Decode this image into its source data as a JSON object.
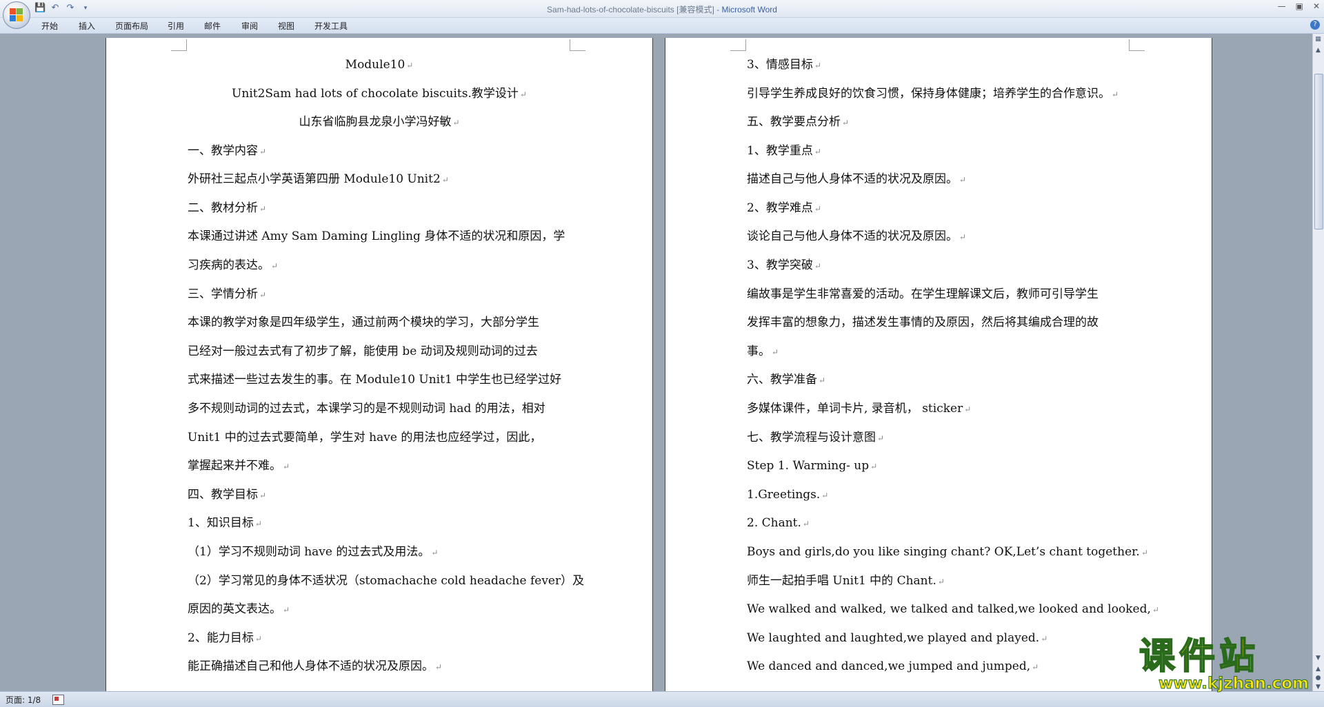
{
  "window": {
    "title_doc": "Sam-had-lots-of-chocolate-biscuits [兼容模式] - ",
    "title_app": "Microsoft Word"
  },
  "ribbon": {
    "tabs": [
      "开始",
      "插入",
      "页面布局",
      "引用",
      "邮件",
      "审阅",
      "视图",
      "开发工具"
    ]
  },
  "page1": {
    "lines": [
      "Module10",
      "Unit2Sam had lots of chocolate biscuits.教学设计",
      "山东省临朐县龙泉小学冯好敏",
      "一、教学内容",
      "外研社三起点小学英语第四册 Module10 Unit2",
      "二、教材分析",
      "本课通过讲述 Amy Sam Daming Lingling 身体不适的状况和原因，学",
      "习疾病的表达。",
      "三、学情分析",
      "本课的教学对象是四年级学生，通过前两个模块的学习，大部分学生",
      "已经对一般过去式有了初步了解，能使用 be 动词及规则动词的过去",
      "式来描述一些过去发生的事。在 Module10 Unit1 中学生也已经学过好",
      "多不规则动词的过去式，本课学习的是不规则动词 had 的用法，相对",
      "Unit1  中的过去式要简单，学生对  have  的用法也应经学过，因此，",
      "掌握起来并不难。",
      "四、教学目标",
      "1、知识目标",
      "（1）学习不规则动词 have 的过去式及用法。",
      "（2）学习常见的身体不适状况（stomachache cold headache fever）及",
      "原因的英文表达。",
      "2、能力目标",
      "能正确描述自己和他人身体不适的状况及原因。"
    ]
  },
  "page2": {
    "lines": [
      "3、情感目标",
      "引导学生养成良好的饮食习惯，保持身体健康；培养学生的合作意识。",
      "五、教学要点分析",
      "1、教学重点",
      "描述自己与他人身体不适的状况及原因。",
      "2、教学难点",
      "谈论自己与他人身体不适的状况及原因。",
      "3、教学突破",
      "编故事是学生非常喜爱的活动。在学生理解课文后，教师可引导学生",
      "发挥丰富的想象力，描述发生事情的及原因，然后将其编成合理的故",
      "事。",
      "六、教学准备",
      "多媒体课件，单词卡片, 录音机，  sticker",
      "七、教学流程与设计意图",
      "Step 1. Warming- up",
      "1.Greetings.",
      "2. Chant.",
      "Boys and girls,do you like singing chant? OK,Let’s chant together.",
      "师生一起拍手唱 Unit1 中的 Chant.",
      "We walked and walked, we talked and talked,we looked and looked,",
      "We laughted and laughted,we played and played.",
      "We danced and danced,we jumped and jumped,"
    ]
  },
  "status": {
    "page_indicator": "页面: 1/8"
  },
  "watermark": {
    "name": "课件站",
    "url": "www.kjzhan.com"
  },
  "colors": {
    "workspace": "#9ba6b5",
    "ribbon": "#d5e0ef",
    "title_app": "#3a5fa0"
  }
}
